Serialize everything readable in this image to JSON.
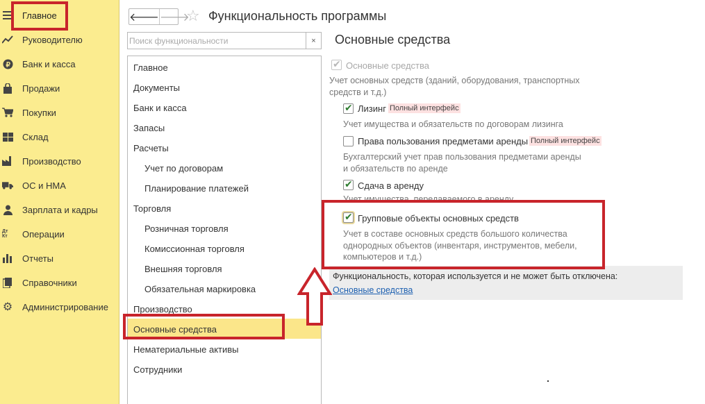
{
  "sidebar": {
    "items": [
      {
        "label": "Главное",
        "icon": "hamburger-menu-icon"
      },
      {
        "label": "Руководителю",
        "icon": "trend-chart-icon"
      },
      {
        "label": "Банк и касса",
        "icon": "ruble-coin-icon"
      },
      {
        "label": "Продажи",
        "icon": "shopping-bag-icon"
      },
      {
        "label": "Покупки",
        "icon": "shopping-cart-icon"
      },
      {
        "label": "Склад",
        "icon": "warehouse-grid-icon"
      },
      {
        "label": "Производство",
        "icon": "factory-icon"
      },
      {
        "label": "ОС и НМА",
        "icon": "truck-icon"
      },
      {
        "label": "Зарплата и кадры",
        "icon": "person-icon"
      },
      {
        "label": "Операции",
        "icon": "debit-credit-icon"
      },
      {
        "label": "Отчеты",
        "icon": "bar-chart-icon"
      },
      {
        "label": "Справочники",
        "icon": "books-icon"
      },
      {
        "label": "Администрирование",
        "icon": "gear-icon"
      }
    ],
    "debit_credit_glyph": "Дт Кт"
  },
  "header": {
    "back_glyph": "🡐",
    "forward_glyph": "🡒",
    "star_glyph": "☆",
    "title": "Функциональность программы"
  },
  "search": {
    "placeholder": "Поиск функциональности",
    "value": "",
    "clear_glyph": "×"
  },
  "sections": [
    {
      "label": "Главное",
      "indent": 0
    },
    {
      "label": "Документы",
      "indent": 0
    },
    {
      "label": "Банк и касса",
      "indent": 0
    },
    {
      "label": "Запасы",
      "indent": 0
    },
    {
      "label": "Расчеты",
      "indent": 0
    },
    {
      "label": "Учет по договорам",
      "indent": 1
    },
    {
      "label": "Планирование платежей",
      "indent": 1
    },
    {
      "label": "Торговля",
      "indent": 0
    },
    {
      "label": "Розничная торговля",
      "indent": 1
    },
    {
      "label": "Комиссионная торговля",
      "indent": 1
    },
    {
      "label": "Внешняя торговля",
      "indent": 1
    },
    {
      "label": "Обязательная маркировка",
      "indent": 1
    },
    {
      "label": "Производство",
      "indent": 0
    },
    {
      "label": "Основные средства",
      "indent": 0,
      "selected": true
    },
    {
      "label": "Нематериальные активы",
      "indent": 0
    },
    {
      "label": "Сотрудники",
      "indent": 0
    }
  ],
  "content": {
    "title": "Основные средства",
    "main_option": {
      "label": "Основные средства",
      "checked": true,
      "disabled": true,
      "desc_lines": [
        "Учет основных средств (зданий, оборудования, транспортных",
        "средств и т.д.)"
      ]
    },
    "options": [
      {
        "label": "Лизинг",
        "checked": true,
        "badge": "Полный интерфейс",
        "desc_lines": [
          "Учет имущества и обязательств  по договорам лизинга"
        ]
      },
      {
        "label": "Права пользования предметами аренды",
        "checked": false,
        "badge": "Полный интерфейс",
        "desc_lines": [
          "Бухгалтерский учет прав пользования предметами аренды",
          "и обязательств по аренде"
        ]
      },
      {
        "label": "Сдача в аренду",
        "checked": true,
        "badge": "",
        "desc_lines": [
          "Учет имущества, передаваемого в аренду"
        ]
      },
      {
        "label": "Групповые объекты основных средств",
        "checked": true,
        "badge": "",
        "desc_lines": [
          "Учет в составе основных средств большого количества",
          "однородных объектов (инвентаря, инструментов, мебели,",
          "компьютеров и т.д.)"
        ]
      }
    ],
    "fixed_note": "Функциональность, которая используется и не может быть отключена:",
    "fixed_link": "Основные средства"
  },
  "colors": {
    "sidebar_bg": "#fbec8f",
    "selected_row": "#fbe68a",
    "annotation_red": "#c8242b",
    "link": "#1c5fb0",
    "badge_bg": "#fde1e1",
    "check_green": "#2f7d31"
  }
}
